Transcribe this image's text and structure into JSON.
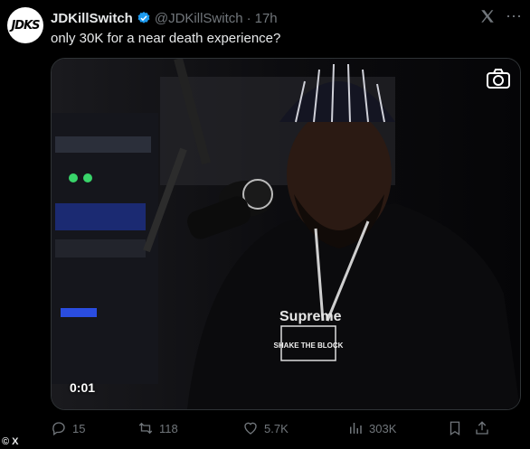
{
  "tweet": {
    "avatar_label": "JDKS",
    "display_name": "JDKillSwitch",
    "handle": "@JDKillSwitch",
    "separator": "·",
    "time": "17h",
    "text": "only 30K for a near death experience?",
    "verified_color": "#1d9bf0"
  },
  "media": {
    "timestamp": "0:01",
    "shirt_brand": "Supreme",
    "pendant_text": "SHAKE THE BLOCK"
  },
  "actions": {
    "replies": "15",
    "reposts": "118",
    "likes": "5.7K",
    "views": "303K"
  },
  "footer": {
    "copyright": "© X"
  }
}
